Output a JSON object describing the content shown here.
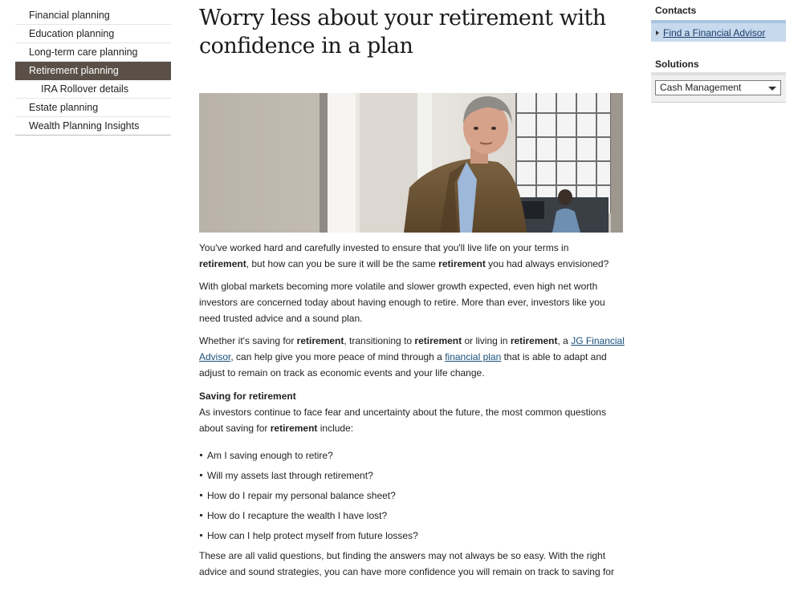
{
  "left_nav": {
    "items": [
      {
        "label": "Financial planning"
      },
      {
        "label": "Education planning"
      },
      {
        "label": "Long-term care planning"
      },
      {
        "label": "Retirement planning"
      },
      {
        "label": "IRA Rollover details"
      },
      {
        "label": "Estate planning"
      },
      {
        "label": "Wealth Planning Insights"
      }
    ]
  },
  "main": {
    "title_line1": "Worry less about your retirement with",
    "title_line2": "confidence in a plan",
    "p1": {
      "a": "You've worked hard and carefully invested to ensure that you'll live life on your terms in",
      "b1": "retirement",
      "c": ", but how can you be sure it will be the same ",
      "b2": "retirement",
      "d": " you had always envisioned?"
    },
    "p2": "With global markets becoming more volatile and slower growth expected, even high net worth investors are concerned today about having enough to retire. More than ever, investors like you need trusted advice and a sound plan.",
    "p3": {
      "a": "Whether it's saving for ",
      "b1": "retirement",
      "c": ", transitioning to ",
      "b2": "retirement",
      "d": " or living in ",
      "b3": "retirement",
      "e": ", a ",
      "link1": "JG Financial Advisor",
      "f": ", can help give you more peace of mind through a ",
      "link2": "financial plan",
      "g": " that is able to adapt and adjust to remain on track as economic events and your life change."
    },
    "section_heading": "Saving for retirement",
    "p4": {
      "a": "As investors continue to face fear and uncertainty about the future, the most common questions about saving for ",
      "b1": "retirement",
      "c": " include:"
    },
    "bullets": [
      "Am I saving enough to retire?",
      "Will my assets last through retirement?",
      "How do I repair my personal balance sheet?",
      "How do I recapture the wealth I have lost?",
      "How can I help protect myself from future losses?"
    ],
    "p5": "These are all valid questions, but finding the answers may not always be so easy. With the right advice and sound strategies, you can have more confidence you will remain on track to saving for"
  },
  "right": {
    "contacts_heading": "Contacts",
    "contact_link": "Find a Financial Advisor",
    "solutions_heading": "Solutions",
    "solutions_selected": "Cash Management"
  },
  "colors": {
    "nav_active_bg": "#5a5047",
    "contact_box_bg": "#c7d9ec",
    "link": "#1a4f7a"
  }
}
